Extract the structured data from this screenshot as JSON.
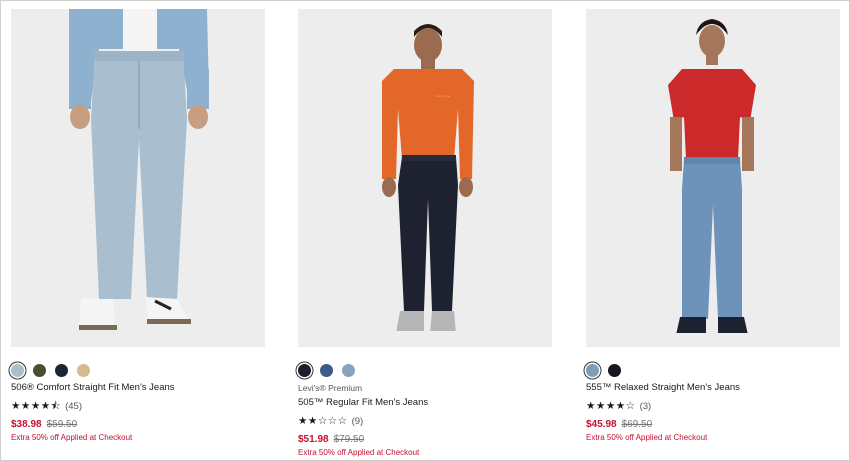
{
  "colors": {
    "sale": "#c41230",
    "photo_bg": "#ececec"
  },
  "products": [
    {
      "brand": "",
      "title": "506® Comfort Straight Fit Men's Jeans",
      "stars": "★★★★⯪",
      "review_count": "(45)",
      "sale_price": "$38.98",
      "original_price": "$59.50",
      "promo": "Extra 50% off Applied at Checkout",
      "swatches": [
        "#a9bec9",
        "#4b4f2f",
        "#1d2533",
        "#d6b98d"
      ],
      "image_desc": "light-wash-straight-jeans-model-photo"
    },
    {
      "brand": "Levi's® Premium",
      "title": "505™ Regular Fit Men's Jeans",
      "stars": "★★☆☆☆",
      "review_count": "(9)",
      "sale_price": "$51.98",
      "original_price": "$79.50",
      "promo": "Extra 50% off Applied at Checkout",
      "swatches": [
        "#1a1f2b",
        "#3d5a8a",
        "#8aa3bd"
      ],
      "image_desc": "dark-rinse-regular-jeans-model-photo"
    },
    {
      "brand": "",
      "title": "555™ Relaxed Straight Men's Jeans",
      "stars": "★★★★☆",
      "review_count": "(3)",
      "sale_price": "$45.98",
      "original_price": "$69.50",
      "promo": "Extra 50% off Applied at Checkout",
      "swatches": [
        "#7d9db8",
        "#15181f"
      ],
      "image_desc": "medium-wash-relaxed-jeans-model-photo"
    }
  ]
}
